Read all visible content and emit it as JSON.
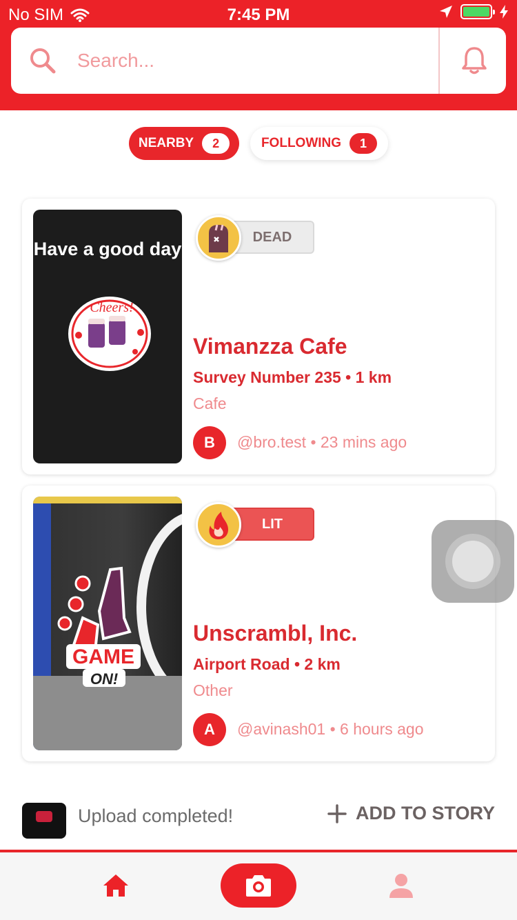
{
  "status_bar": {
    "carrier": "No SIM",
    "time": "7:45 PM"
  },
  "search": {
    "placeholder": "Search..."
  },
  "tabs": [
    {
      "label": "NEARBY",
      "count": "2",
      "active": true
    },
    {
      "label": "FOLLOWING",
      "count": "1",
      "active": false
    }
  ],
  "posts": [
    {
      "image_caption": "Have a good day",
      "badge": "DEAD",
      "title": "Vimanzza Cafe",
      "subtitle": "Survey Number 235 • 1 km",
      "category": "Cafe",
      "avatar_initial": "B",
      "meta": "@bro.test • 23 mins ago"
    },
    {
      "badge": "LIT",
      "title": "Unscrambl, Inc.",
      "subtitle": "Airport Road • 2 km",
      "category": "Other",
      "avatar_initial": "A",
      "meta": "@avinash01 • 6 hours ago"
    }
  ],
  "upload": {
    "status": "Upload completed!",
    "action_label": "ADD TO STORY"
  },
  "colors": {
    "brand": "#ec2228",
    "muted_pink": "#ef8a8d",
    "dead_badge": "#ececec",
    "lit_badge": "#eb5454"
  },
  "icons": [
    "search-icon",
    "bell-icon",
    "home-icon",
    "camera-icon",
    "profile-icon",
    "plus-icon"
  ]
}
